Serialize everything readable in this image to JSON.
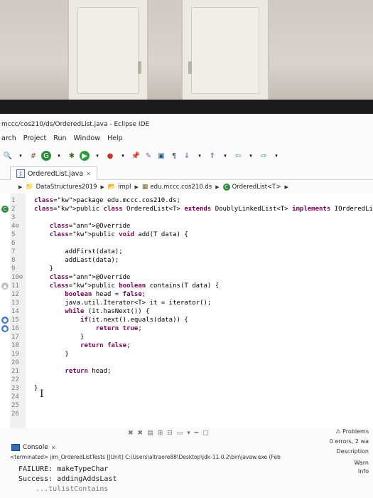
{
  "window": {
    "title": "mccc/cos210/ds/OrderedList.java - Eclipse IDE"
  },
  "menu": [
    "arch",
    "Project",
    "Run",
    "Window",
    "Help"
  ],
  "editor_tab": {
    "label": "OrderedList.java",
    "close": "✕"
  },
  "breadcrumb": {
    "project": "DataStructures2019",
    "folder": "impl",
    "package": "edu.mccc.cos210.ds",
    "class": "OrderedList<T>"
  },
  "code_lines": [
    {
      "n": "1",
      "text": "package edu.mccc.cos210.ds;"
    },
    {
      "n": "2",
      "text": "public class OrderedList<T> extends DoublyLinkedList<T> implements IOrderedList<T> {"
    },
    {
      "n": "3",
      "text": ""
    },
    {
      "n": "4⊖",
      "text": "    @Override"
    },
    {
      "n": "5",
      "text": "    public void add(T data) {"
    },
    {
      "n": "6",
      "text": ""
    },
    {
      "n": "7",
      "text": "        addFirst(data);"
    },
    {
      "n": "8",
      "text": "        addLast(data);"
    },
    {
      "n": "9",
      "text": "    }"
    },
    {
      "n": "10⊖",
      "text": "    @Override"
    },
    {
      "n": "11",
      "text": "    public boolean contains(T data) {"
    },
    {
      "n": "12",
      "text": "        boolean head = false;"
    },
    {
      "n": "13",
      "text": "        java.util.Iterator<T> it = iterator();"
    },
    {
      "n": "14",
      "text": "        while (it.hasNext()) {"
    },
    {
      "n": "15",
      "text": "            if(it.next().equals(data)) {"
    },
    {
      "n": "16",
      "text": "                return true;"
    },
    {
      "n": "17",
      "text": "            }"
    },
    {
      "n": "18",
      "text": "            return false;"
    },
    {
      "n": "19",
      "text": "        }"
    },
    {
      "n": "20",
      "text": ""
    },
    {
      "n": "21",
      "text": "        return head;"
    },
    {
      "n": "22",
      "text": ""
    },
    {
      "n": "23",
      "text": "}"
    },
    {
      "n": "24",
      "text": ""
    },
    {
      "n": "25",
      "text": ""
    },
    {
      "n": "26",
      "text": ""
    }
  ],
  "console": {
    "tab_label": "Console",
    "terminated": "<terminated> jim_OrderedListTests [JUnit] C:\\Users\\altraore88\\Desktop\\jdk-11.0.2\\bin\\javaw.exe (Feb",
    "lines": [
      "FAILURE: makeTypeChar",
      "Success: addingAddsLast",
      "    ...tulistContains"
    ]
  },
  "problems_panel": {
    "title": "Problems",
    "summary": "0 errors, 2 wa",
    "column": "Description",
    "warnings": "Warn",
    "infos": "Info"
  }
}
